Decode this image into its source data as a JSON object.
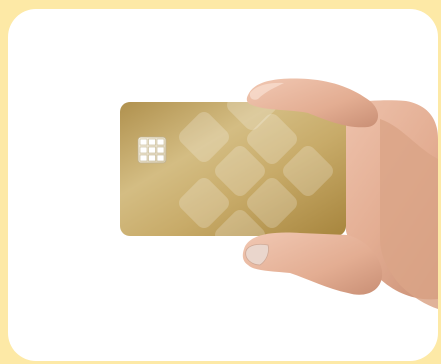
{
  "scene": {
    "subject": "hand-holding-payment-card",
    "frame_background": "#ffffff",
    "page_background": "#fde9a6",
    "card_color": "#c9ad6c",
    "skin_color": "#e9b79e"
  }
}
